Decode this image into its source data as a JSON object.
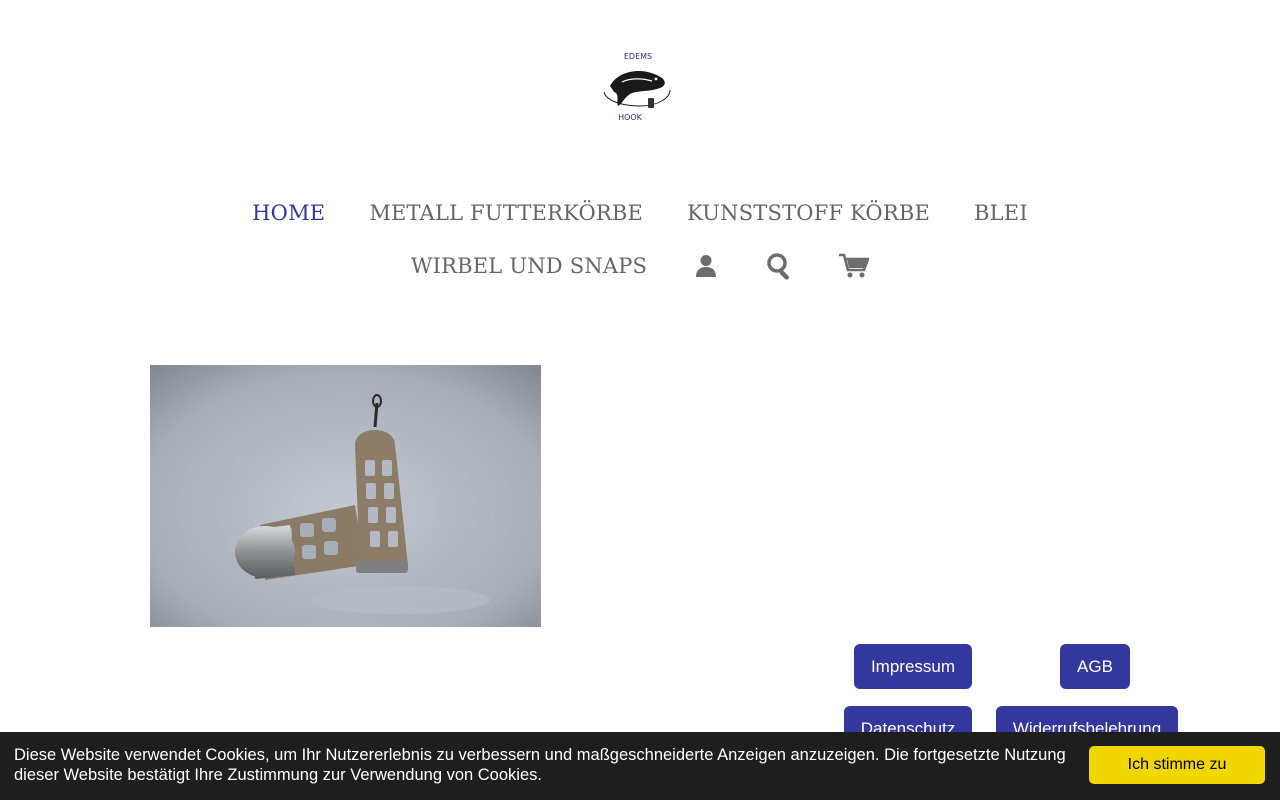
{
  "logo": {
    "text_top": "EDEMS",
    "text_bottom": "HOOK"
  },
  "nav": {
    "items": [
      {
        "label": "HOME",
        "active": true
      },
      {
        "label": "METALL FUTTERKÖRBE"
      },
      {
        "label": "KUNSTSTOFF KÖRBE"
      },
      {
        "label": "BLEI"
      },
      {
        "label": "WIRBEL UND SNAPS"
      }
    ],
    "icons": [
      "user-icon",
      "search-icon",
      "cart-icon"
    ]
  },
  "footer": {
    "buttons": [
      "Impressum",
      "AGB",
      "Datenschutz",
      "Widerrufsbelehrung"
    ]
  },
  "cookie": {
    "text": "Diese Website verwendet Cookies, um Ihr Nutzererlebnis zu verbessern und maßgeschneiderte Anzeigen anzuzeigen. Die fortgesetzte Nutzung dieser Website bestätigt Ihre Zustimmung zur Verwendung von Cookies.",
    "accept": "Ich stimme zu"
  },
  "colors": {
    "accent": "#33389e",
    "nav_text": "#666666",
    "cookie_bg": "#1e1e1e",
    "cookie_button": "#f1d600"
  }
}
